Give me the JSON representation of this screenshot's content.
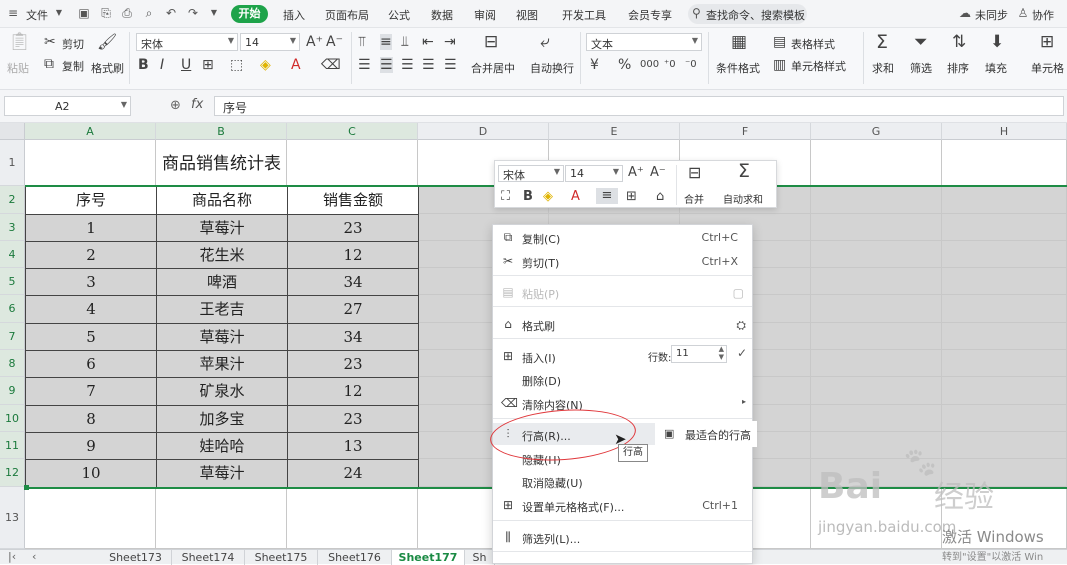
{
  "menubar": {
    "file": "文件",
    "tabs": [
      "开始",
      "插入",
      "页面布局",
      "公式",
      "数据",
      "审阅",
      "视图",
      "开发工具",
      "会员专享"
    ],
    "search": "查找命令、搜索模板",
    "sync": "未同步",
    "collab": "协作"
  },
  "ribbon": {
    "paste": "粘贴",
    "cut": "剪切",
    "copy": "复制",
    "format_painter": "格式刷",
    "font_name": "宋体",
    "font_size": "14",
    "merge": "合并居中",
    "wrap": "自动换行",
    "number_format": "文本",
    "currency": "¥",
    "percent": "%",
    "table_style": "表格样式",
    "cond_format": "条件格式",
    "cell_style": "单元格样式",
    "sum": "求和",
    "filter": "筛选",
    "sort": "排序",
    "fill": "填充",
    "cell": "单元格"
  },
  "formula_bar": {
    "cell_ref": "A2",
    "fx": "fx",
    "value": "序号"
  },
  "columns": [
    "A",
    "B",
    "C",
    "D",
    "E",
    "F",
    "G",
    "H"
  ],
  "rows": [
    "1",
    "2",
    "3",
    "4",
    "5",
    "6",
    "7",
    "8",
    "9",
    "10",
    "11",
    "12",
    "13"
  ],
  "table": {
    "title": "商品销售统计表",
    "headers": [
      "序号",
      "商品名称",
      "销售金额"
    ],
    "rows": [
      [
        "1",
        "草莓汁",
        "23"
      ],
      [
        "2",
        "花生米",
        "12"
      ],
      [
        "3",
        "啤酒",
        "34"
      ],
      [
        "4",
        "王老吉",
        "27"
      ],
      [
        "5",
        "草莓汁",
        "34"
      ],
      [
        "6",
        "苹果汁",
        "23"
      ],
      [
        "7",
        "矿泉水",
        "12"
      ],
      [
        "8",
        "加多宝",
        "23"
      ],
      [
        "9",
        "娃哈哈",
        "13"
      ],
      [
        "10",
        "草莓汁",
        "24"
      ]
    ]
  },
  "sheets": [
    "Sheet173",
    "Sheet174",
    "Sheet175",
    "Sheet176",
    "Sheet177",
    "Sh"
  ],
  "active_sheet": "Sheet177",
  "minibar": {
    "font_name": "宋体",
    "font_size": "14",
    "merge": "合并",
    "autosum": "自动求和"
  },
  "context_menu": {
    "copy": "复制(C)",
    "copy_sc": "Ctrl+C",
    "cut": "剪切(T)",
    "cut_sc": "Ctrl+X",
    "paste": "粘贴(P)",
    "format_painter": "格式刷",
    "insert": "插入(I)",
    "rows_label": "行数:",
    "rows_value": "11",
    "delete": "删除(D)",
    "clear": "清除内容(N)",
    "row_height": "行高(R)...",
    "hide": "隐藏(H)",
    "unhide": "取消隐藏(U)",
    "cell_format": "设置单元格格式(F)...",
    "cell_format_sc": "Ctrl+1",
    "filter_col": "筛选列(L)..."
  },
  "submenu": {
    "best_fit": "最适合的行高"
  },
  "tooltip": "行高",
  "watermark": {
    "brand": "Bai",
    "brand2": "经验",
    "url": "jingyan.baidu.com",
    "activate": "激活 Windows",
    "activate_sub": "转到\"设置\"以激活 Win"
  },
  "colors": {
    "accent": "#1ea34a",
    "selection_border": "#1e8c45",
    "selected_fill": "#d4d4d4",
    "annotation": "#e0373b"
  }
}
